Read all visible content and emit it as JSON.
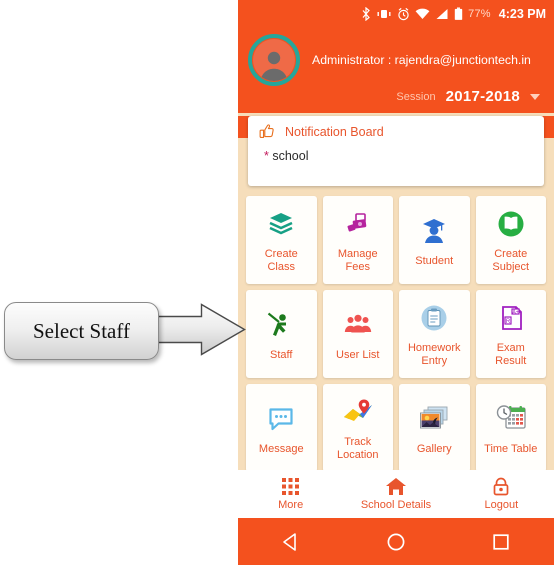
{
  "annotation": {
    "label": "Select Staff",
    "arrow_icon": "right-arrow-icon"
  },
  "statusbar": {
    "icons": [
      "bluetooth-icon",
      "vibrate-icon",
      "alarm-icon",
      "wifi-icon",
      "signal-icon",
      "battery-icon"
    ],
    "battery": "77%",
    "time": "4:23 PM"
  },
  "header": {
    "avatar_icon": "user-avatar-icon",
    "admin_text": "Administrator : rajendra@junctiontech.in",
    "session_label": "Session",
    "session_value": "2017-2018",
    "dropdown_icon": "chevron-down-icon"
  },
  "notification": {
    "icon": "thumbs-up-icon",
    "title": "Notification Board",
    "bullet": "*",
    "item": "school"
  },
  "grid": {
    "tiles": [
      {
        "label": "Create\nClass",
        "label_line1": "Create",
        "label_line2": "Class",
        "icon": "layers-icon",
        "color": "#17a085"
      },
      {
        "label": "Manage Fees",
        "label_line1": "Manage",
        "label_line2": "Fees",
        "icon": "money-icon",
        "color": "#b5239e"
      },
      {
        "label": "Student",
        "label_line1": "Student",
        "label_line2": "",
        "icon": "graduate-student-icon",
        "color": "#2f6fd0"
      },
      {
        "label": "Create Subject",
        "label_line1": "Create",
        "label_line2": "Subject",
        "icon": "book-circle-icon",
        "color": "#27ae43"
      },
      {
        "label": "Staff",
        "label_line1": "Staff",
        "label_line2": "",
        "icon": "teacher-pointer-icon",
        "color": "#1d7a1d"
      },
      {
        "label": "User List",
        "label_line1": "User List",
        "label_line2": "",
        "icon": "people-group-icon",
        "color": "#ef5350"
      },
      {
        "label": "Homework Entry",
        "label_line1": "Homework",
        "label_line2": "Entry",
        "icon": "clipboard-circle-icon",
        "color": "#79b4dd"
      },
      {
        "label": "Exam Result",
        "label_line1": "Exam",
        "label_line2": "Result",
        "icon": "exam-paper-icon",
        "color": "#a020c0"
      },
      {
        "label": "Message",
        "label_line1": "Message",
        "label_line2": "",
        "icon": "speech-bubble-icon",
        "color": "#5bb8e8"
      },
      {
        "label": "Track Location",
        "label_line1": "Track",
        "label_line2": "Location",
        "icon": "map-pin-icon",
        "color": "#7cb342"
      },
      {
        "label": "Gallery",
        "label_line1": "Gallery",
        "label_line2": "",
        "icon": "photo-stack-icon",
        "color": "#e07b2a"
      },
      {
        "label": "Time Table",
        "label_line1": "Time Table",
        "label_line2": "",
        "icon": "clock-calendar-icon",
        "color": "#4caf50"
      }
    ]
  },
  "bottomnav": {
    "items": [
      {
        "label": "More",
        "icon": "grid-apps-icon"
      },
      {
        "label": "School Details",
        "icon": "home-icon"
      },
      {
        "label": "Logout",
        "icon": "lock-icon"
      }
    ]
  },
  "navbar": {
    "back_icon": "triangle-back-icon",
    "home_icon": "circle-home-icon",
    "recents_icon": "square-recents-icon"
  },
  "colors": {
    "primary_orange": "#f4511e",
    "label_orange": "#e8552d",
    "background_peach": "#f6debb",
    "avatar_ring_teal": "#26a69a",
    "card_white": "#fffefb"
  }
}
